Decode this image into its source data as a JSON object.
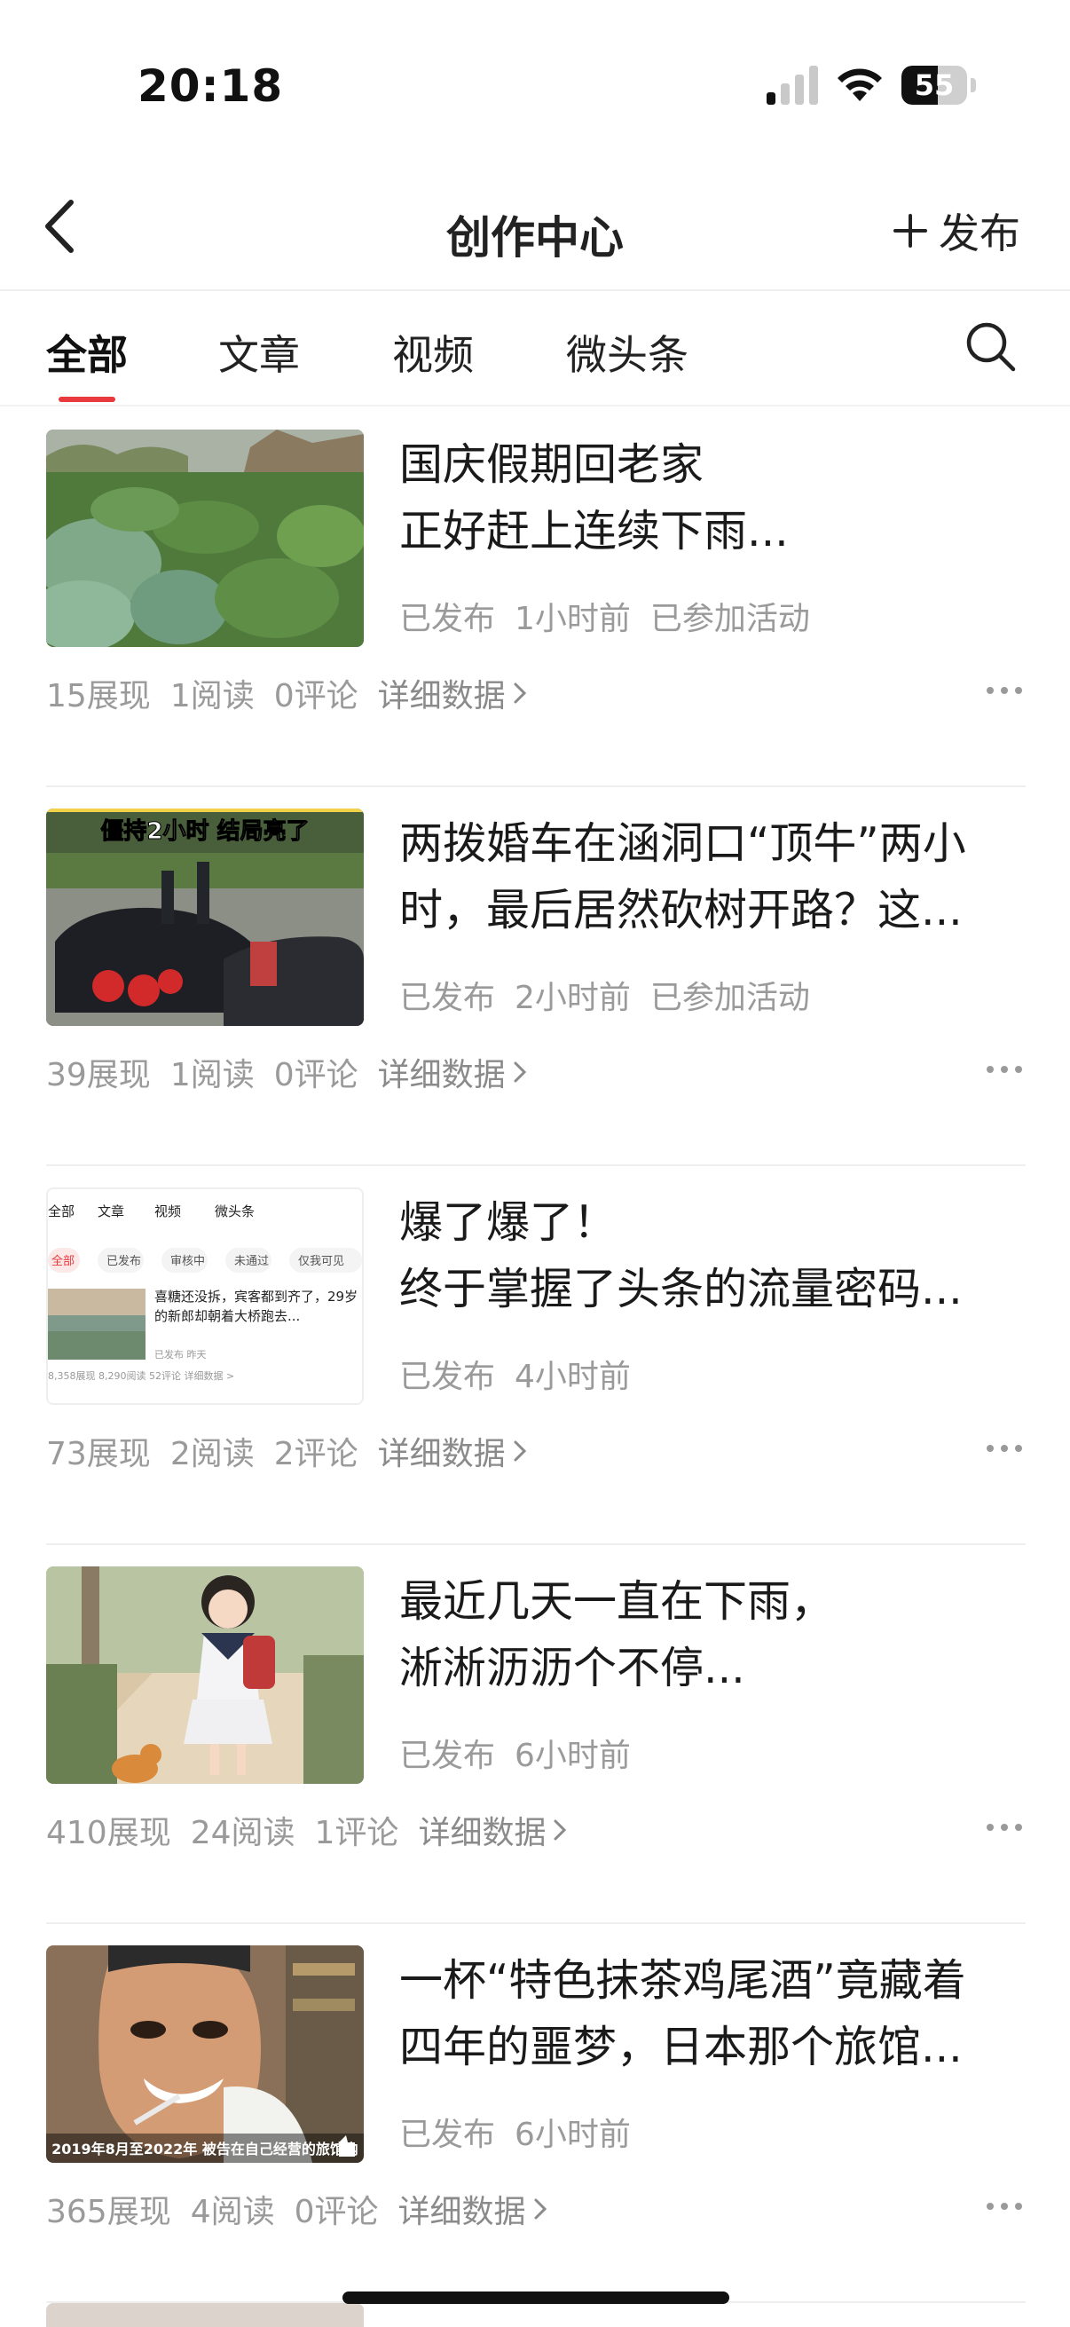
{
  "status_bar": {
    "time": "20:18",
    "battery": "55",
    "battery_level": 0.55
  },
  "nav": {
    "title": "创作中心",
    "publish_label": "发布",
    "icons": {
      "back": "chevron-left-icon",
      "publish": "plus-icon"
    }
  },
  "tabs": [
    {
      "label": "全部",
      "active": true
    },
    {
      "label": "文章",
      "active": false
    },
    {
      "label": "视频",
      "active": false
    },
    {
      "label": "微头条",
      "active": false
    }
  ],
  "accent_color": "#e8393d",
  "posts": [
    {
      "title_lines": [
        "国庆假期回老家",
        "正好赶上连续下雨..."
      ],
      "status": "已发布",
      "time": "1小时前",
      "activity": "已参加活动",
      "impressions": "15展现",
      "reads": "1阅读",
      "comments": "0评论",
      "detail": "详细数据"
    },
    {
      "title_lines": [
        "两拨婚车在涵洞口“顶牛”两小",
        "时，最后居然砍树开路？这..."
      ],
      "status": "已发布",
      "time": "2小时前",
      "activity": "已参加活动",
      "impressions": "39展现",
      "reads": "1阅读",
      "comments": "0评论",
      "detail": "详细数据",
      "thumb_caption": "僵持2小时  结局亮了"
    },
    {
      "title_lines": [
        "爆了爆了！",
        "终于掌握了头条的流量密码..."
      ],
      "status": "已发布",
      "time": "4小时前",
      "activity": "",
      "impressions": "73展现",
      "reads": "2阅读",
      "comments": "2评论",
      "detail": "详细数据",
      "thumb_screenshot": {
        "tabs": [
          "全部",
          "文章",
          "视频",
          "微头条"
        ],
        "chips": [
          "全部",
          "已发布",
          "审核中",
          "未通过",
          "仅我可见"
        ],
        "item_title": "喜糖还没拆，宾客都到齐了，29岁的新郎却朝着大桥跑去...",
        "item_meta": "已发布  昨天",
        "item_stats": "8,358展现  8,290阅读  52评论  详细数据 >"
      }
    },
    {
      "title_lines": [
        "最近几天一直在下雨，",
        "淅淅沥沥个不停..."
      ],
      "status": "已发布",
      "time": "6小时前",
      "activity": "",
      "impressions": "410展现",
      "reads": "24阅读",
      "comments": "1评论",
      "detail": "详细数据"
    },
    {
      "title_lines": [
        "一杯“特色抹茶鸡尾酒”竟藏着",
        "四年的噩梦，日本那个旅馆..."
      ],
      "status": "已发布",
      "time": "6小时前",
      "activity": "",
      "impressions": "365展现",
      "reads": "4阅读",
      "comments": "0评论",
      "detail": "详细数据",
      "thumb_caption": "2019年8月至2022年 被告在自己经营的旅馆内"
    }
  ]
}
